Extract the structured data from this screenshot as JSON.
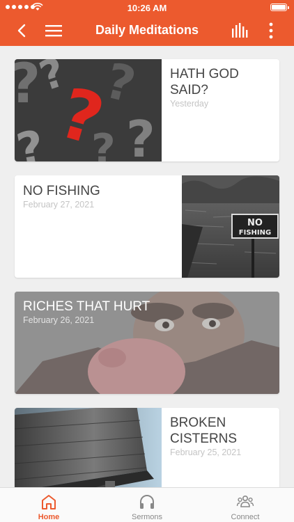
{
  "status": {
    "time": "10:26 AM"
  },
  "nav": {
    "title": "Daily Meditations"
  },
  "colors": {
    "accent": "#ec5a2e"
  },
  "cards": [
    {
      "title": "HATH GOD SAID?",
      "date": "Yesterday",
      "image": "red-question-mark-image"
    },
    {
      "title": "NO FISHING",
      "date": "February 27, 2021",
      "image": "no-fishing-sign-image",
      "sign_text": "NO FISHING"
    },
    {
      "title": "RICHES THAT HURT",
      "date": "February 26, 2021",
      "image": "man-with-piggy-bank-image"
    },
    {
      "title": "BROKEN CISTERNS",
      "date": "February 25, 2021",
      "image": "water-tower-image"
    }
  ],
  "tabs": [
    {
      "label": "Home",
      "icon": "home-icon",
      "active": true
    },
    {
      "label": "Sermons",
      "icon": "headphones-icon",
      "active": false
    },
    {
      "label": "Connect",
      "icon": "people-icon",
      "active": false
    }
  ]
}
